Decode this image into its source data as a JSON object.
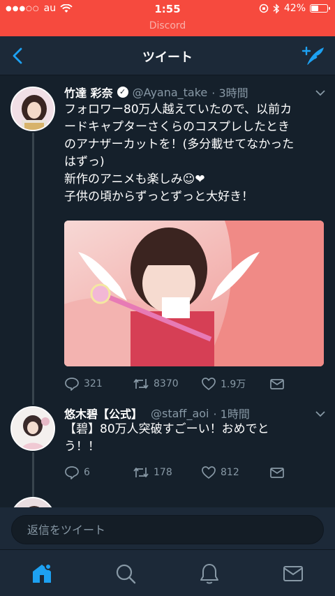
{
  "status_bar": {
    "carrier": "au",
    "time": "1:55",
    "battery_text": "42%",
    "battery_level": 0.42,
    "return_app": "Discord"
  },
  "nav": {
    "title": "ツイート"
  },
  "tweets": [
    {
      "name": "竹達 彩奈",
      "handle": "@Ayana_take",
      "time": "· 3時間",
      "verified": true,
      "text": "フォロワー80万人越えていたので、以前カ\nードキャプターさくらのコスプレしたとき\nのアナザーカットを！(多分載せてなかった\nはずっ)\n新作のアニメも楽しみ☺︎❤︎\n子供の頃からずっとずっと大好き！",
      "replies": "321",
      "retweets": "8370",
      "likes": "1.9万"
    },
    {
      "name": "悠木碧【公式】",
      "handle": "@staff_aoi",
      "time": "· 1時間",
      "verified": false,
      "text": "【碧】80万人突破すごーい！おめでと\nう！！",
      "replies": "6",
      "retweets": "178",
      "likes": "812"
    }
  ],
  "reply": {
    "placeholder": "返信をツイート"
  },
  "colors": {
    "status_bar": "#f64a3e",
    "background": "#15202b",
    "nav_background": "#1c2938",
    "accent": "#1da1f2",
    "secondary_text": "#8899a6"
  },
  "icons": [
    "back-chevron-icon",
    "compose-tweet-icon",
    "verified-badge-icon",
    "chevron-down-icon",
    "reply-icon",
    "retweet-icon",
    "like-icon",
    "share-dm-icon",
    "home-icon",
    "search-icon",
    "notifications-icon",
    "messages-icon"
  ]
}
